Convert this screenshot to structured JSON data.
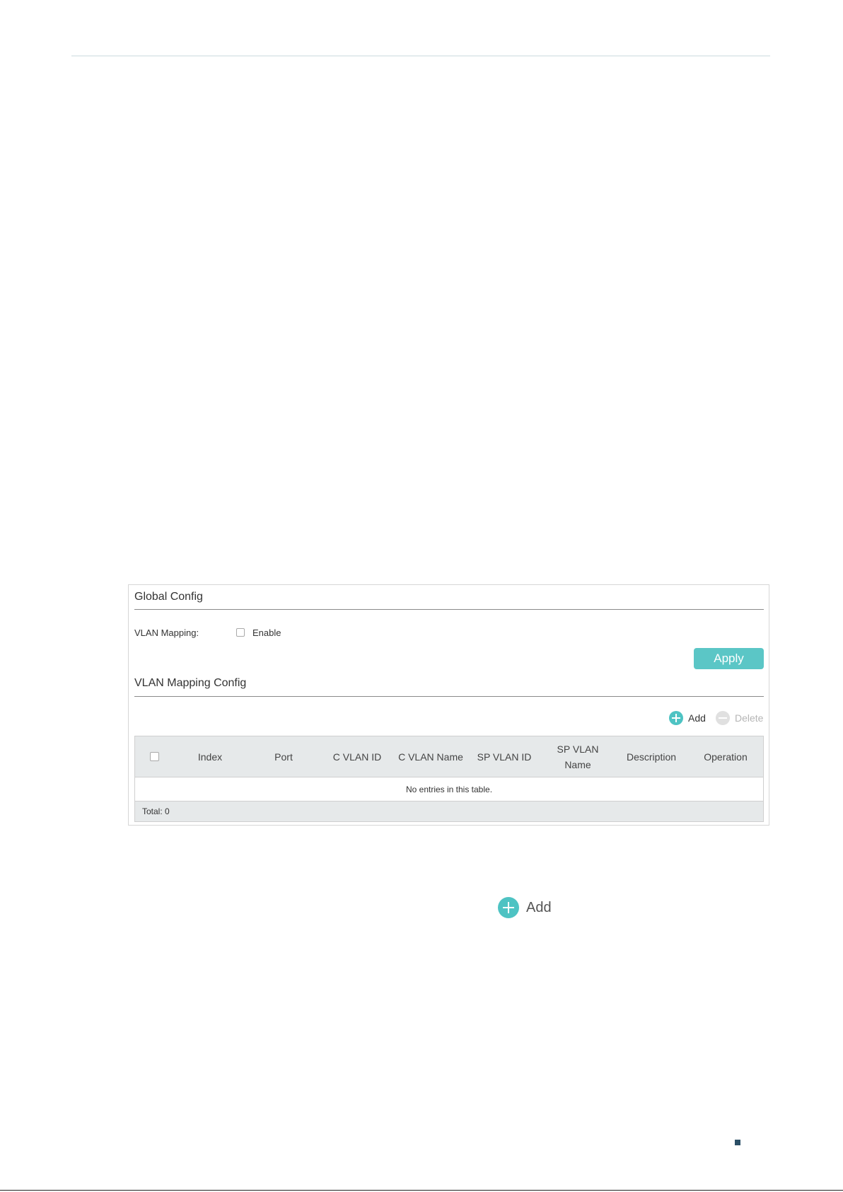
{
  "global_config": {
    "title": "Global Config",
    "vlan_mapping_label": "VLAN Mapping:",
    "enable_label": "Enable",
    "apply_label": "Apply"
  },
  "mapping_config": {
    "title": "VLAN Mapping Config",
    "add_label": "Add",
    "delete_label": "Delete",
    "columns": [
      "Index",
      "Port",
      "C VLAN ID",
      "C VLAN Name",
      "SP VLAN ID",
      "SP VLAN Name",
      "Description",
      "Operation"
    ],
    "empty_message": "No entries in this table.",
    "total": "Total: 0"
  },
  "standalone_add": {
    "label": "Add"
  },
  "colors": {
    "accent": "#5bc6c6",
    "header_bg": "#e6e9ea"
  }
}
